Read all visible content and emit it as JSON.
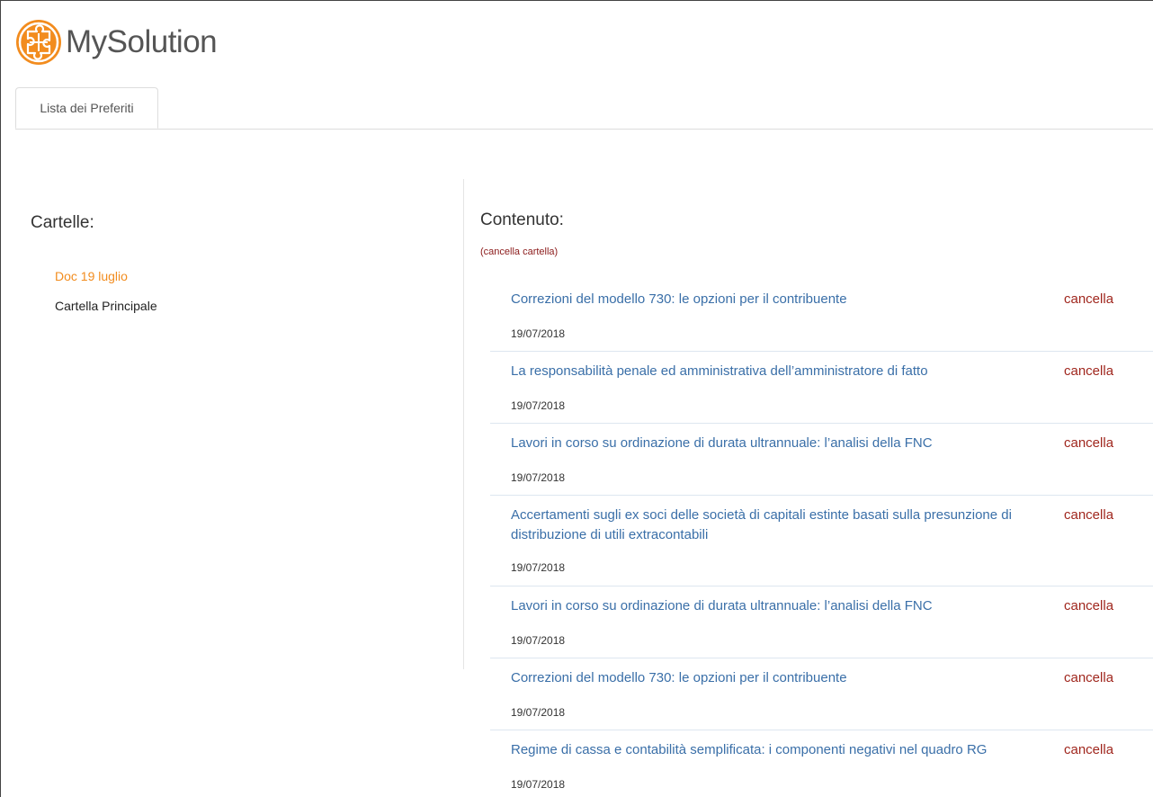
{
  "brand": {
    "name": "MySolution",
    "logo_icon": "puzzle-logo-icon",
    "accent_color": "#f28c1e"
  },
  "tabs": [
    {
      "label": "Lista dei Preferiti",
      "active": true
    }
  ],
  "folders": {
    "title": "Cartelle:",
    "items": [
      {
        "label": "Doc 19 luglio",
        "active": true
      },
      {
        "label": "Cartella Principale",
        "active": false
      }
    ]
  },
  "content": {
    "title": "Contenuto:",
    "delete_folder_label": "(cancella cartella)",
    "items": [
      {
        "title": "Correzioni del modello 730: le opzioni per il contribuente",
        "date": "19/07/2018",
        "delete_label": "cancella"
      },
      {
        "title": "La responsabilità penale ed amministrativa dell’amministratore di fatto",
        "date": "19/07/2018",
        "delete_label": "cancella"
      },
      {
        "title": "Lavori in corso su ordinazione di durata ultrannuale: l’analisi della FNC",
        "date": "19/07/2018",
        "delete_label": "cancella"
      },
      {
        "title": "Accertamenti sugli ex soci delle società di capitali estinte basati sulla presunzione di distribuzione di utili extracontabili",
        "date": "19/07/2018",
        "delete_label": "cancella"
      },
      {
        "title": "Lavori in corso su ordinazione di durata ultrannuale: l’analisi della FNC",
        "date": "19/07/2018",
        "delete_label": "cancella"
      },
      {
        "title": "Correzioni del modello 730: le opzioni per il contribuente",
        "date": "19/07/2018",
        "delete_label": "cancella"
      },
      {
        "title": "Regime di cassa e contabilità semplificata: i componenti negativi nel quadro RG",
        "date": "19/07/2018",
        "delete_label": "cancella"
      }
    ]
  }
}
